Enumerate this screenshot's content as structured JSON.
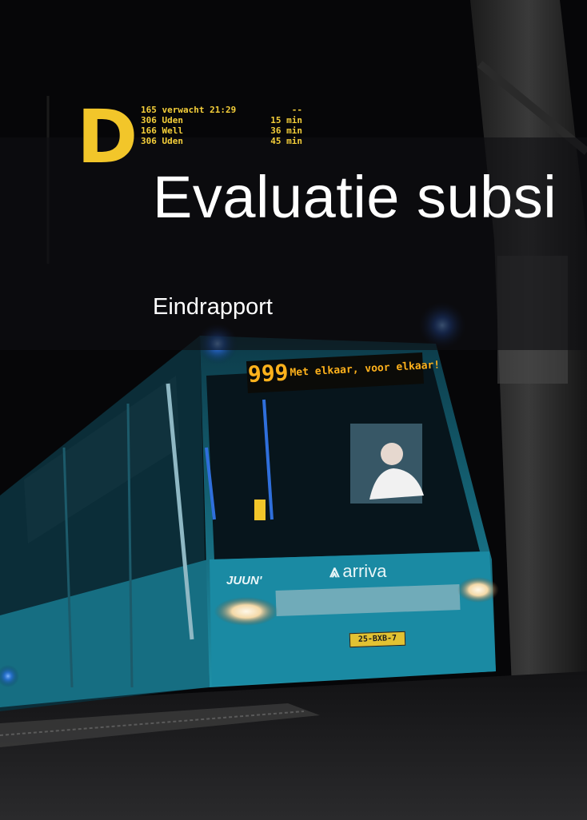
{
  "cover": {
    "title": "Evaluatie subsi",
    "subtitle": "Eindrapport"
  },
  "departure_board": {
    "platform": "D",
    "rows": [
      {
        "route": "165 verwacht 21:29",
        "time": "--"
      },
      {
        "route": "306 Uden",
        "time": "15 min"
      },
      {
        "route": "166 Well",
        "time": "36 min"
      },
      {
        "route": "306 Uden",
        "time": "45 min"
      }
    ]
  },
  "bus": {
    "route_number": "999",
    "destination_text": "Met elkaar, voor elkaar!",
    "brand": "arriva",
    "brand_icon": "arriva-logo-icon",
    "side_label": "JUUN'",
    "license_plate": "25-BXB-7"
  },
  "colors": {
    "led_yellow": "#f2c62a",
    "bus_teal": "#1b8aa0",
    "band_overlay": "#0f0f12"
  }
}
